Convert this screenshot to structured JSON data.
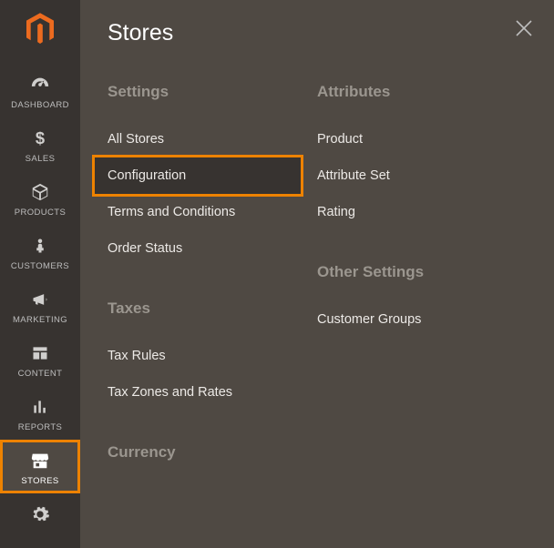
{
  "panel_title": "Stores",
  "sidebar": {
    "items": [
      {
        "label": "DASHBOARD",
        "icon": "gauge-icon"
      },
      {
        "label": "SALES",
        "icon": "dollar-icon"
      },
      {
        "label": "PRODUCTS",
        "icon": "box-icon"
      },
      {
        "label": "CUSTOMERS",
        "icon": "person-icon"
      },
      {
        "label": "MARKETING",
        "icon": "megaphone-icon"
      },
      {
        "label": "CONTENT",
        "icon": "layout-icon"
      },
      {
        "label": "REPORTS",
        "icon": "bar-chart-icon"
      },
      {
        "label": "STORES",
        "icon": "store-icon"
      }
    ],
    "active_index": 7,
    "highlight_index": 7
  },
  "groups": {
    "left": [
      {
        "heading": "Settings",
        "items": [
          "All Stores",
          "Configuration",
          "Terms and Conditions",
          "Order Status"
        ],
        "highlight_index": 1
      },
      {
        "heading": "Taxes",
        "items": [
          "Tax Rules",
          "Tax Zones and Rates"
        ]
      },
      {
        "heading": "Currency",
        "items": []
      }
    ],
    "right": [
      {
        "heading": "Attributes",
        "items": [
          "Product",
          "Attribute Set",
          "Rating"
        ]
      },
      {
        "heading": "Other Settings",
        "items": [
          "Customer Groups"
        ]
      }
    ]
  },
  "colors": {
    "accent": "#ed8200",
    "panel": "#4f4943",
    "sidebar": "#373330"
  }
}
